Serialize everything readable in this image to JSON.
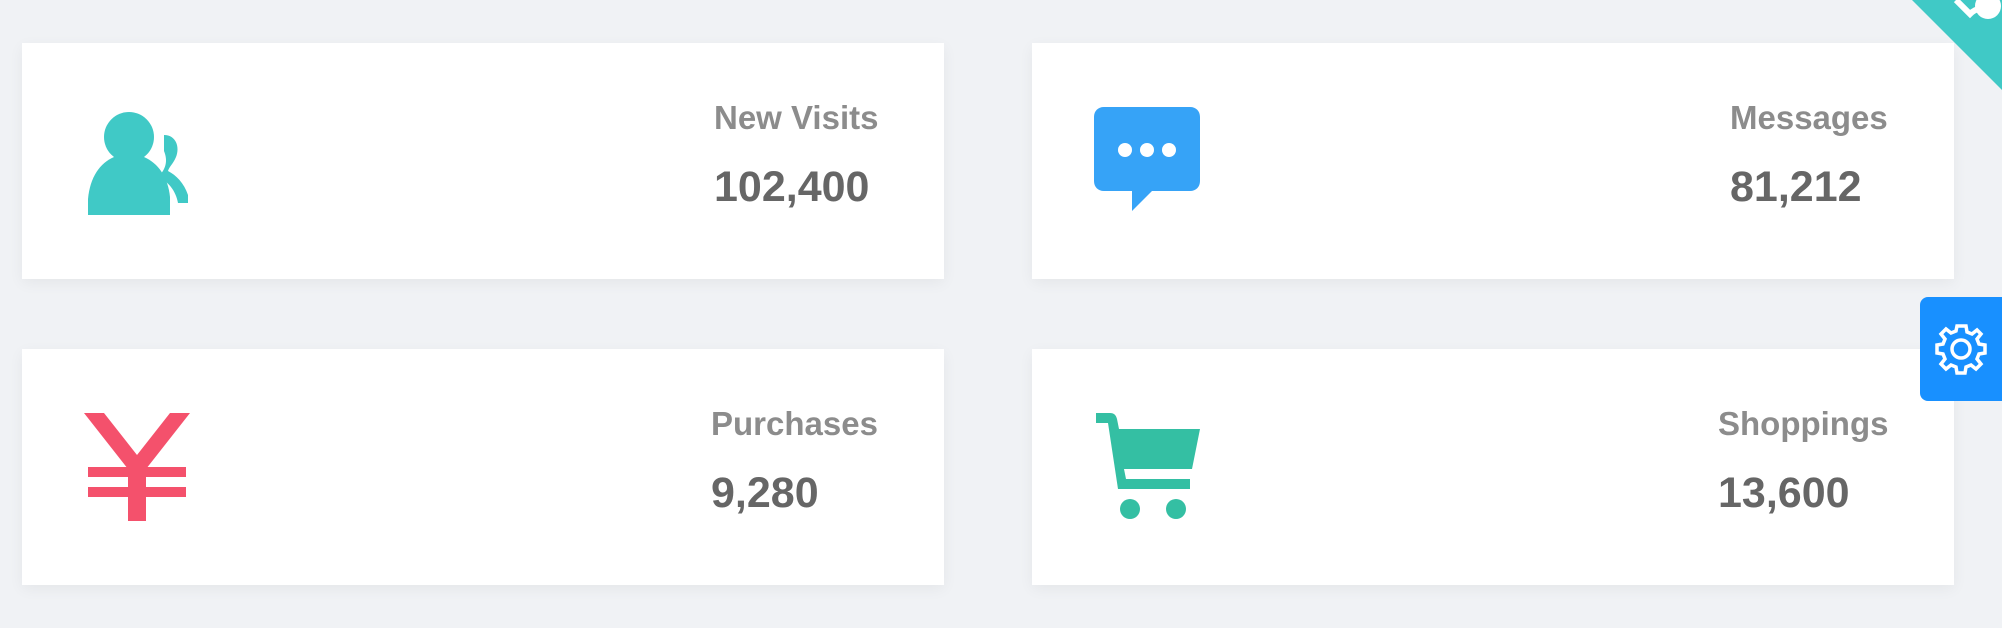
{
  "panels": [
    {
      "label": "New Visits",
      "value": "102,400",
      "icon": "people-icon",
      "color": "#40c9c6"
    },
    {
      "label": "Messages",
      "value": "81,212",
      "icon": "message-icon",
      "color": "#36a3f7"
    },
    {
      "label": "Purchases",
      "value": "9,280",
      "icon": "money-icon",
      "color": "#f4516c"
    },
    {
      "label": "Shoppings",
      "value": "13,600",
      "icon": "shopping-cart-icon",
      "color": "#34bfa3"
    }
  ],
  "corner_ribbon": {
    "icon": "github-corner-icon",
    "color": "#40c9c6"
  },
  "settings_button": {
    "icon": "gear-icon",
    "color": "#1890ff"
  }
}
